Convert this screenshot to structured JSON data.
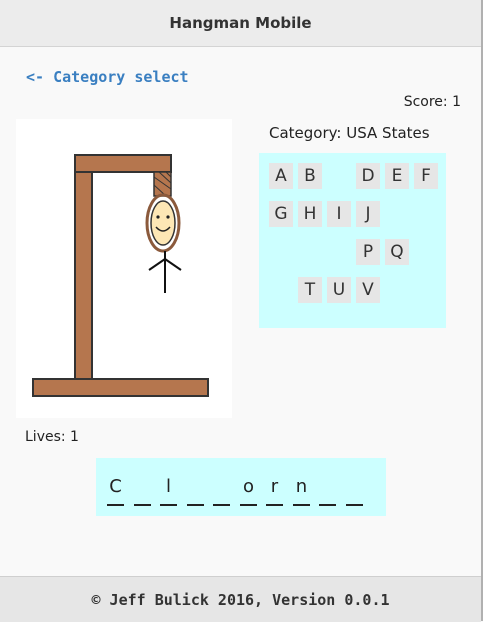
{
  "header": {
    "title": "Hangman Mobile"
  },
  "nav": {
    "back_label": "<- Category select"
  },
  "game": {
    "score_text": "Score: 1",
    "category_text": "Category: USA States",
    "lives_text": "Lives: 1",
    "lives_remaining": 1
  },
  "keyboard": {
    "rows": [
      [
        "A",
        "B",
        "",
        "D",
        "E",
        "F"
      ],
      [
        "G",
        "H",
        "I",
        "J",
        "",
        ""
      ],
      [
        "",
        "",
        "",
        "P",
        "Q",
        ""
      ],
      [
        "",
        "T",
        "U",
        "V",
        "",
        ""
      ]
    ]
  },
  "word": {
    "slots": [
      "C",
      "",
      "l",
      "",
      "",
      "o",
      "r",
      "n",
      "",
      ""
    ]
  },
  "colors": {
    "accent_link": "#3a7fc1",
    "panel_cyan": "#ccffff",
    "gallows_wood": "#b5764e",
    "rope": "#8b5a3c"
  },
  "footer": {
    "text": "© Jeff Bulick 2016, Version 0.0.1"
  }
}
